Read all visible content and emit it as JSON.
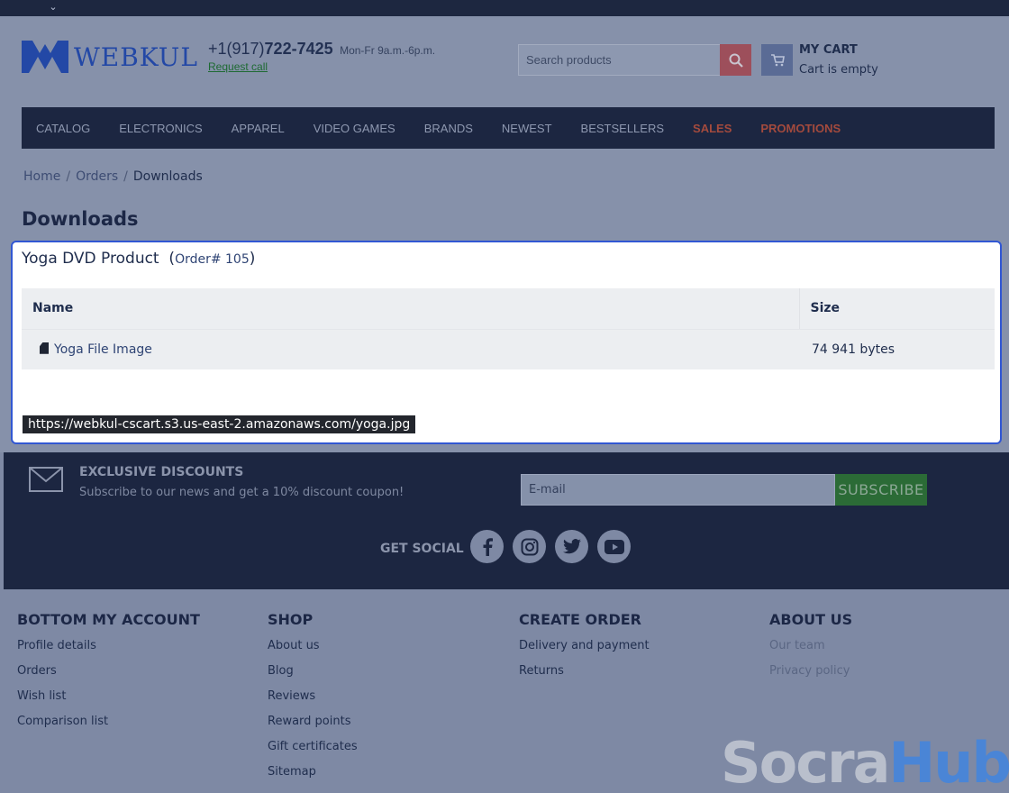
{
  "topbar": {
    "chevron_icon": "chevron-down-icon"
  },
  "header": {
    "logo_text": "WEBKUL",
    "phone_prefix": "+1(917)",
    "phone_main": "722-7425",
    "hours": "Mon-Fr 9a.m.-6p.m.",
    "request_call": "Request call",
    "search_placeholder": "Search products",
    "search_icon": "search-icon",
    "cart_icon": "cart-icon",
    "cart_title": "MY CART",
    "cart_status": "Cart is empty"
  },
  "nav": {
    "items": [
      {
        "label": "CATALOG"
      },
      {
        "label": "ELECTRONICS"
      },
      {
        "label": "APPAREL"
      },
      {
        "label": "VIDEO GAMES"
      },
      {
        "label": "BRANDS"
      },
      {
        "label": "NEWEST"
      },
      {
        "label": "BESTSELLERS"
      },
      {
        "label": "SALES"
      },
      {
        "label": "PROMOTIONS"
      }
    ],
    "highlight_color": "#a34a3d"
  },
  "breadcrumb": {
    "home": "Home",
    "orders": "Orders",
    "current": "Downloads",
    "separator": "/"
  },
  "page_title": "Downloads",
  "download_card": {
    "product": "Yoga DVD Product",
    "order_label": "Order# 105",
    "columns": [
      "Name",
      "Size"
    ],
    "rows": [
      {
        "name": "Yoga File Image",
        "size": "74 941 bytes",
        "icon": "file-icon"
      }
    ],
    "url_tooltip": "https://webkul-cscart.s3.us-east-2.amazonaws.com/yoga.jpg",
    "focus_color": "#3157d3"
  },
  "newsletter": {
    "mail_icon": "envelope-icon",
    "heading": "EXCLUSIVE DISCOUNTS",
    "subtitle": "Subscribe to our news and get a 10% discount coupon!",
    "email_placeholder": "E-mail",
    "subscribe_label": "SUBSCRIBE",
    "social_label": "GET SOCIAL",
    "social_icons": [
      "facebook-icon",
      "instagram-icon",
      "twitter-icon",
      "youtube-icon"
    ]
  },
  "footer": {
    "columns": [
      {
        "heading": "BOTTOM MY ACCOUNT",
        "links": [
          "Profile details",
          "Orders",
          "Wish list",
          "Comparison list"
        ]
      },
      {
        "heading": "SHOP",
        "links": [
          "About us",
          "Blog",
          "Reviews",
          "Reward points",
          "Gift certificates",
          "Sitemap"
        ]
      },
      {
        "heading": "CREATE ORDER",
        "links": [
          "Delivery and payment",
          "Returns"
        ]
      },
      {
        "heading": "ABOUT US",
        "links": [
          "Our team",
          "Privacy policy"
        ]
      }
    ]
  },
  "watermark": {
    "part1": "Socra",
    "part2": "Hub"
  }
}
